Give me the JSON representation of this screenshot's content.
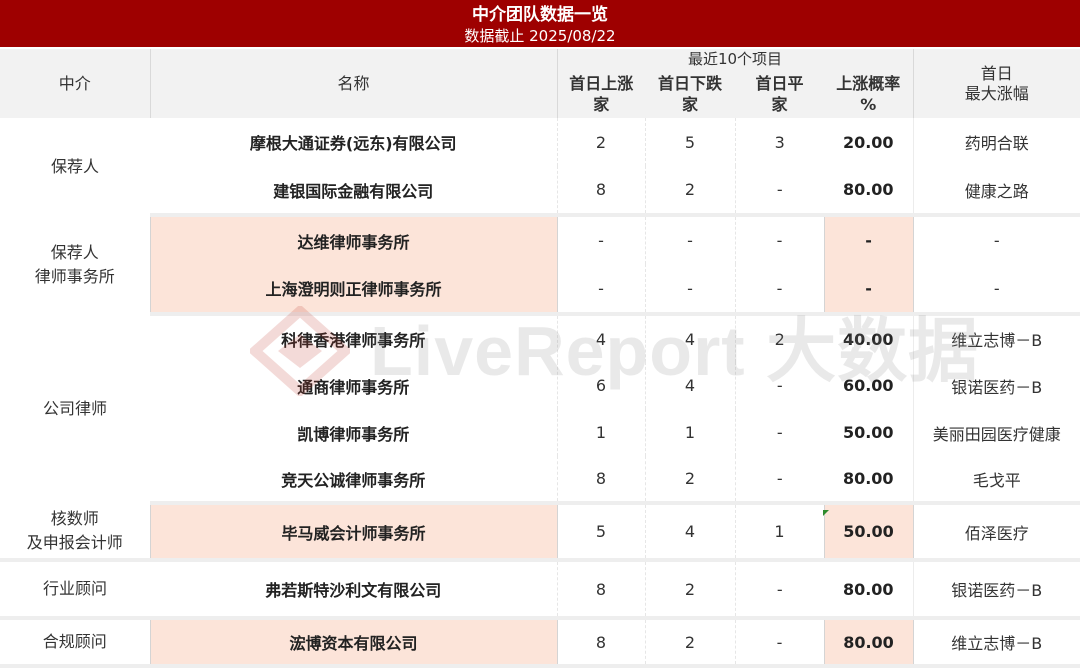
{
  "header": {
    "title": "中介团队数据一览",
    "subtitle": "数据截止 2025/08/22"
  },
  "columns": {
    "agency": "中介",
    "name": "名称",
    "group_label": "最近10个项目",
    "rise": [
      "首日上涨",
      "家"
    ],
    "fall": [
      "首日下跌",
      "家"
    ],
    "flat": [
      "首日平",
      "家"
    ],
    "rate": [
      "上涨概率",
      "%"
    ],
    "max": [
      "首日",
      "最大涨幅"
    ]
  },
  "groups": [
    {
      "category": [
        "保荐人"
      ],
      "rows": [
        {
          "name": "摩根大通证券(远东)有限公司",
          "rise": "2",
          "fall": "5",
          "flat": "3",
          "rate": "20.00",
          "max": "药明合联"
        },
        {
          "name": "建银国际金融有限公司",
          "rise": "8",
          "fall": "2",
          "flat": "-",
          "rate": "80.00",
          "max": "健康之路"
        }
      ]
    },
    {
      "category": [
        "保荐人",
        "律师事务所"
      ],
      "rows": [
        {
          "name": "达维律师事务所",
          "rise": "-",
          "fall": "-",
          "flat": "-",
          "rate": "-",
          "max": "-"
        },
        {
          "name": "上海澄明则正律师事务所",
          "rise": "-",
          "fall": "-",
          "flat": "-",
          "rate": "-",
          "max": "-"
        }
      ]
    },
    {
      "category": [
        "公司律师"
      ],
      "rows": [
        {
          "name": "科律香港律师事务所",
          "rise": "4",
          "fall": "4",
          "flat": "2",
          "rate": "40.00",
          "max": "维立志博－B"
        },
        {
          "name": "通商律师事务所",
          "rise": "6",
          "fall": "4",
          "flat": "-",
          "rate": "60.00",
          "max": "银诺医药－B"
        },
        {
          "name": "凯博律师事务所",
          "rise": "1",
          "fall": "1",
          "flat": "-",
          "rate": "50.00",
          "max": "美丽田园医疗健康"
        },
        {
          "name": "竞天公诚律师事务所",
          "rise": "8",
          "fall": "2",
          "flat": "-",
          "rate": "80.00",
          "max": "毛戈平"
        }
      ]
    },
    {
      "category": [
        "核数师",
        "及申报会计师"
      ],
      "rows": [
        {
          "name": "毕马威会计师事务所",
          "rise": "5",
          "fall": "4",
          "flat": "1",
          "rate": "50.00",
          "max": "佰泽医疗"
        }
      ]
    },
    {
      "category": [
        "行业顾问"
      ],
      "rows": [
        {
          "name": "弗若斯特沙利文有限公司",
          "rise": "8",
          "fall": "2",
          "flat": "-",
          "rate": "80.00",
          "max": "银诺医药－B"
        }
      ]
    },
    {
      "category": [
        "合规顾问"
      ],
      "rows": [
        {
          "name": "浤博资本有限公司",
          "rise": "8",
          "fall": "2",
          "flat": "-",
          "rate": "80.00",
          "max": "维立志博－B"
        }
      ]
    }
  ],
  "watermark": {
    "text": "LiveReport 大数据"
  },
  "colors": {
    "header_bg": "#9e0000",
    "highlight": "#fce4d9",
    "head_bg": "#f2f2f2"
  }
}
